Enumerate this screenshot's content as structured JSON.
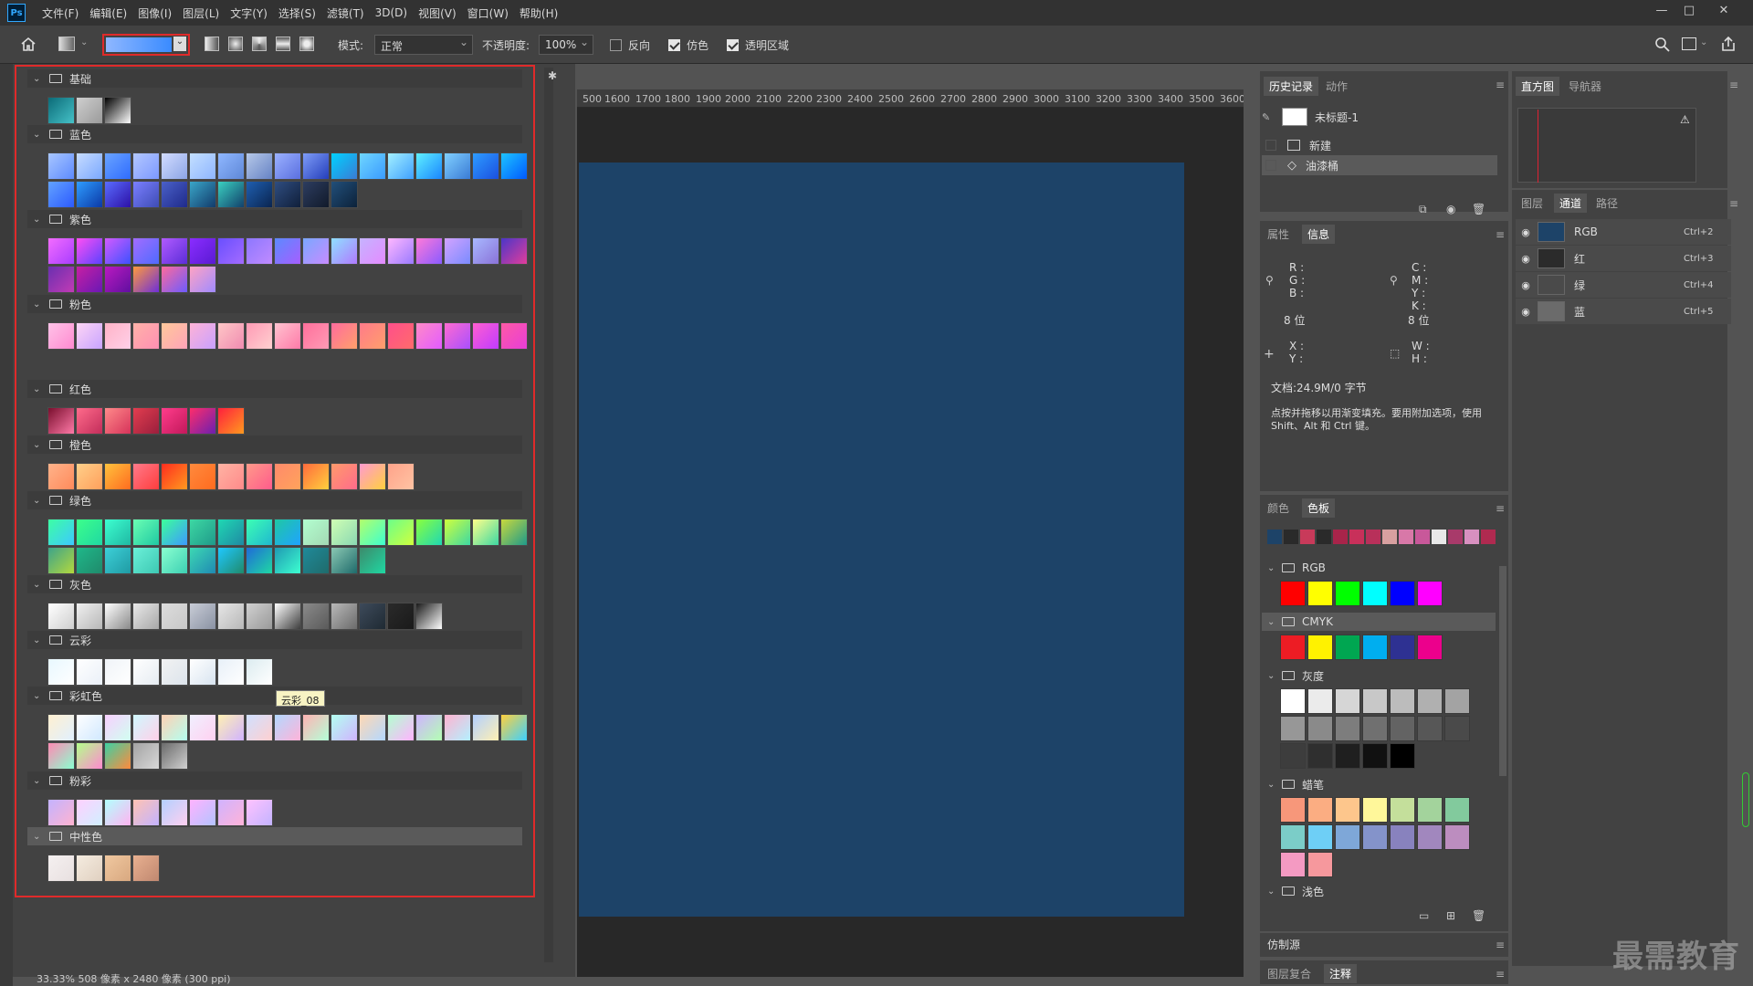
{
  "app": {
    "logo": "Ps"
  },
  "menu": [
    "文件(F)",
    "编辑(E)",
    "图像(I)",
    "图层(L)",
    "文字(Y)",
    "选择(S)",
    "滤镜(T)",
    "3D(D)",
    "视图(V)",
    "窗口(W)",
    "帮助(H)"
  ],
  "window_controls": {
    "minimize": "—",
    "restore": "□",
    "close": "✕"
  },
  "options": {
    "mode_label": "模式:",
    "mode_value": "正常",
    "opacity_label": "不透明度:",
    "opacity_value": "100%",
    "reverse_label": "反向",
    "reverse_checked": false,
    "dither_label": "仿色",
    "dither_checked": true,
    "transparency_label": "透明区域",
    "transparency_checked": true
  },
  "gradient_panel": {
    "groups": [
      {
        "name": "基础",
        "swatches": [
          [
            "#0b6b78",
            "#46c2c8"
          ],
          [
            "#cfcfcf",
            "#9a9a9a"
          ],
          [
            "#000000",
            "#ffffff"
          ]
        ]
      },
      {
        "name": "蓝色",
        "swatches": [
          [
            "#a8c6ff",
            "#5d8bff"
          ],
          [
            "#c7dcff",
            "#7aa8ff"
          ],
          [
            "#6aa4ff",
            "#2f6cff"
          ],
          [
            "#b3c7ff",
            "#7c99ff"
          ],
          [
            "#d2dcff",
            "#8ca5e6"
          ],
          [
            "#c3dfff",
            "#8fb6ff"
          ],
          [
            "#8fb7ff",
            "#5f88d8"
          ],
          [
            "#b6c8e8",
            "#6683c5"
          ],
          [
            "#9bb1ff",
            "#5a6fe0"
          ],
          [
            "#7e9cf7",
            "#243ebb"
          ],
          [
            "#00d2ff",
            "#3a7bd5"
          ],
          [
            "#6fd6ff",
            "#3a9bff"
          ],
          [
            "#a3f0ff",
            "#3fa0ff"
          ],
          [
            "#5ef0ff",
            "#1a86ff"
          ],
          [
            "#80d0ff",
            "#3a7bd5"
          ],
          [
            "#2d9cff",
            "#1b4fe0"
          ],
          [
            "#1dc4ff",
            "#0059ff"
          ],
          [
            "#62a2ff",
            "#2c5aff"
          ],
          [
            "#2e9cff",
            "#0b39a6"
          ],
          [
            "#5a6cff",
            "#2c10a6"
          ],
          [
            "#7a7fff",
            "#3e4cb5"
          ],
          [
            "#4a60c8",
            "#1f2a8a"
          ],
          [
            "#3aa6c8",
            "#123b6b"
          ],
          [
            "#3ad0c0",
            "#12406b"
          ],
          [
            "#1f5eb0",
            "#0a2550"
          ],
          [
            "#2f4d80",
            "#101f3a"
          ],
          [
            "#2d3d60",
            "#111a2a"
          ],
          [
            "#224f7a",
            "#0c223a"
          ]
        ]
      },
      {
        "name": "紫色",
        "swatches": [
          [
            "#f36cff",
            "#a83dff"
          ],
          [
            "#ff4ff3",
            "#5b42ff"
          ],
          [
            "#d35bff",
            "#3d51ff"
          ],
          [
            "#a26cff",
            "#4f6bff"
          ],
          [
            "#b15bff",
            "#5b2dd8"
          ],
          [
            "#8a2dff",
            "#5a1ad3"
          ],
          [
            "#6a4fff",
            "#a36bff"
          ],
          [
            "#8d77ff",
            "#c08bff"
          ],
          [
            "#5c8aff",
            "#a65eff"
          ],
          [
            "#7aa8ff",
            "#c78bff"
          ],
          [
            "#8fe0ff",
            "#b07aff"
          ],
          [
            "#c5b3ff",
            "#e48bff"
          ],
          [
            "#ffb7ff",
            "#9a7aff"
          ],
          [
            "#ff7ad9",
            "#8a5bff"
          ],
          [
            "#d3a3ff",
            "#7a8bff"
          ],
          [
            "#a8b8ff",
            "#8a72d8"
          ],
          [
            "#4a36c8",
            "#e23d9b"
          ],
          [
            "#6a2fb0",
            "#c23bb5"
          ],
          [
            "#c71fa3",
            "#6a18b5"
          ],
          [
            "#ba1ac0",
            "#600fa0"
          ],
          [
            "#ff9a3d",
            "#6e2fd8"
          ],
          [
            "#ff6b9b",
            "#6d5bff"
          ],
          [
            "#ffa3c3",
            "#a08bff"
          ]
        ]
      },
      {
        "name": "粉色",
        "swatches": [
          [
            "#ffc3e8",
            "#ff8ad0"
          ],
          [
            "#ffd6f5",
            "#c7a3ff"
          ],
          [
            "#ffb3c7",
            "#ffd0e8"
          ],
          [
            "#ffb2a8",
            "#ff8fb3"
          ],
          [
            "#ffc89a",
            "#ffa3b8"
          ],
          [
            "#ffb3d6",
            "#c8a0ff"
          ],
          [
            "#ffc7c7",
            "#f08bb0"
          ],
          [
            "#ff9ab5",
            "#ffd0d0"
          ],
          [
            "#ffc3d0",
            "#ff7aa8"
          ],
          [
            "#ff6f9b",
            "#ff9bb5"
          ],
          [
            "#ff6b9d",
            "#ffa06b"
          ],
          [
            "#ff7a8a",
            "#ff9f6b"
          ],
          [
            "#ff4f8b",
            "#ff6b6b"
          ],
          [
            "#ff8ac7",
            "#e35bff"
          ],
          [
            "#ff6bd0",
            "#a84fff"
          ],
          [
            "#ff5fd0",
            "#c03bff"
          ],
          [
            "#ff5aa5",
            "#e83dd8"
          ]
        ]
      },
      {
        "name": "红色",
        "swatches": [
          [
            "#7a0f2e",
            "#ff7aa8"
          ],
          [
            "#ff6b8b",
            "#c22d5a"
          ],
          [
            "#ff8a8a",
            "#d6335a"
          ],
          [
            "#e23d4f",
            "#9a1f3d"
          ],
          [
            "#ff3d8b",
            "#c2185b"
          ],
          [
            "#ff2d6b",
            "#6b1fb0"
          ],
          [
            "#ff1f3d",
            "#ff9a1f"
          ]
        ]
      },
      {
        "name": "橙色",
        "swatches": [
          [
            "#ffb38a",
            "#ff8a5b"
          ],
          [
            "#ffd08a",
            "#ff9f5b"
          ],
          [
            "#ffc23d",
            "#ff6b1f"
          ],
          [
            "#ff7a8a",
            "#ff3d3d"
          ],
          [
            "#ff2d1f",
            "#ff9a1f"
          ],
          [
            "#ff8a3d",
            "#ff6b1f"
          ],
          [
            "#ffb3a3",
            "#ff8a8a"
          ],
          [
            "#ff9a8a",
            "#ff5b8b"
          ],
          [
            "#ff8a6b",
            "#ffa35b"
          ],
          [
            "#ff6b3d",
            "#ffd03d"
          ],
          [
            "#ff9a6b",
            "#ff6b8b"
          ],
          [
            "#ff9ad0",
            "#ffd03d"
          ],
          [
            "#ffa38a",
            "#ffc3a3"
          ]
        ]
      },
      {
        "name": "绿色",
        "swatches": [
          [
            "#3dffa3",
            "#3dc8ff"
          ],
          [
            "#3dff8a",
            "#1fd8a3"
          ],
          [
            "#3dffd0",
            "#1fb8a3"
          ],
          [
            "#6bffb3",
            "#1fc8a3"
          ],
          [
            "#3dff9a",
            "#3d9aff"
          ],
          [
            "#3dd8a3",
            "#1f9a8a"
          ],
          [
            "#1fd8b3",
            "#1f8aa3"
          ],
          [
            "#3dffb3",
            "#1fb8d0"
          ],
          [
            "#1fc8a3",
            "#1fa3ff"
          ],
          [
            "#b3ffd0",
            "#a3d8b3"
          ],
          [
            "#d0ffb3",
            "#8ad8b3"
          ],
          [
            "#b3ff6b",
            "#3dffd0"
          ],
          [
            "#6bff8a",
            "#d0ff3d"
          ],
          [
            "#8aff3d",
            "#1fd8b3"
          ],
          [
            "#d0ff3d",
            "#3dd8a3"
          ],
          [
            "#ffff8a",
            "#3dd8a3"
          ],
          [
            "#c8d83d",
            "#1f9a8a"
          ],
          [
            "#3da38a",
            "#b3d83d"
          ],
          [
            "#1fb88a",
            "#1f8a6b"
          ],
          [
            "#3dd0d8",
            "#1f9aa3"
          ],
          [
            "#6bf0d8",
            "#3dc8b3"
          ],
          [
            "#8affd0",
            "#3dd0b3"
          ],
          [
            "#3dd8b3",
            "#1f8ab3"
          ],
          [
            "#1fc8ff",
            "#1f8a6b"
          ],
          [
            "#1f6bd8",
            "#1fd8a3"
          ],
          [
            "#1f9ab3",
            "#3dffd0"
          ],
          [
            "#1f8a9a",
            "#1f6b6b"
          ],
          [
            "#8ac8b3",
            "#1f6b6b"
          ],
          [
            "#3d8a6b",
            "#1fd8a3"
          ]
        ]
      },
      {
        "name": "灰色",
        "swatches": [
          [
            "#ffffff",
            "#cfcfcf"
          ],
          [
            "#f0f0f0",
            "#b8b8b8"
          ],
          [
            "#ffffff",
            "#8a8a8a"
          ],
          [
            "#e8e8e8",
            "#a8a8a8"
          ],
          [
            "#dcdcdc",
            "#c8c8c8"
          ],
          [
            "#c8ccd6",
            "#8a92a3"
          ],
          [
            "#e6e6e6",
            "#b8b8b8"
          ],
          [
            "#d0d0d0",
            "#9a9a9a"
          ],
          [
            "#ffffff",
            "#3d3d3d"
          ],
          [
            "#8a8a8a",
            "#5a5a5a"
          ],
          [
            "#b8b8b8",
            "#6b6b6b"
          ],
          [
            "#3d4a5a",
            "#1f2a33"
          ],
          [
            "#2a2a2a",
            "#1a1a1a"
          ],
          [
            "#1a1a1a",
            "#ffffff"
          ]
        ]
      },
      {
        "name": "云彩",
        "swatches": [
          [
            "#e8f8ff",
            "#ffffff"
          ],
          [
            "#ffffff",
            "#eaf0f8"
          ],
          [
            "#f0f4f8",
            "#ffffff"
          ],
          [
            "#ffffff",
            "#e6ecf2"
          ],
          [
            "#f2f2f2",
            "#dce4ec"
          ],
          [
            "#ffffff",
            "#d8e4f0"
          ],
          [
            "#e8f0f8",
            "#ffffff"
          ],
          [
            "#dcecf0",
            "#ffffff"
          ]
        ]
      },
      {
        "name": "彩虹色",
        "swatches": [
          [
            "#fff0d0",
            "#e0f0ff"
          ],
          [
            "#ffffff",
            "#d0e8ff"
          ],
          [
            "#f8d0ff",
            "#d0fff0"
          ],
          [
            "#d0f8ff",
            "#ffd0e8"
          ],
          [
            "#ffd0b3",
            "#b3fff0"
          ],
          [
            "#f0f0ff",
            "#ffd0f0"
          ],
          [
            "#fff0b3",
            "#d0b3ff"
          ],
          [
            "#d0e0ff",
            "#ffd0d0"
          ],
          [
            "#b3d8ff",
            "#ffb3d8"
          ],
          [
            "#ffb3b3",
            "#b3ffd8"
          ],
          [
            "#b3fff0",
            "#d0b3ff"
          ],
          [
            "#ffd8b3",
            "#b3d8ff"
          ],
          [
            "#b3ffd0",
            "#ffb3ff"
          ],
          [
            "#d0b3ff",
            "#b3ffb3"
          ],
          [
            "#ffb3d0",
            "#b3f0ff"
          ],
          [
            "#b3d0ff",
            "#fff0b3"
          ],
          [
            "#ffd03d",
            "#3dd0ff"
          ],
          [
            "#ff8ab3",
            "#8affd0"
          ],
          [
            "#b3ff8a",
            "#ff8ad0"
          ],
          [
            "#3dd0a3",
            "#ff8a3d"
          ],
          [
            "#a3a3a3",
            "#d8d8d8"
          ],
          [
            "#6b6b6b",
            "#d0d0d0"
          ]
        ]
      },
      {
        "name": "粉彩",
        "swatches": [
          [
            "#c3b3ff",
            "#ffb3d0"
          ],
          [
            "#ffd0ff",
            "#d0f0ff"
          ],
          [
            "#b3ffff",
            "#ffb3f0"
          ],
          [
            "#ffc3b3",
            "#c3b3ff"
          ],
          [
            "#b3d0ff",
            "#ffd0f0"
          ],
          [
            "#ffb3ff",
            "#b3c3ff"
          ],
          [
            "#d0b3ff",
            "#ffb3d8"
          ],
          [
            "#ffc3ff",
            "#c3b3ff"
          ]
        ]
      },
      {
        "name": "中性色",
        "swatches": [
          [
            "#f5f0f0",
            "#e8e0e0"
          ],
          [
            "#f5ece0",
            "#e0d0c0"
          ],
          [
            "#f0c8a0",
            "#d8a880"
          ],
          [
            "#e8b090",
            "#c08870"
          ]
        ]
      }
    ],
    "tooltip": "云彩_08"
  },
  "ruler_ticks": [
    "500",
    "1600",
    "1700",
    "1800",
    "1900",
    "2000",
    "2100",
    "2200",
    "2300",
    "2400",
    "2500",
    "2600",
    "2700",
    "2800",
    "2900",
    "3000",
    "3100",
    "3200",
    "3300",
    "3400",
    "3500",
    "3600"
  ],
  "status": "33.33% 508 像素 x 2480 像素 (300 ppi)",
  "history": {
    "tabs": [
      "历史记录",
      "动作"
    ],
    "snapshot": "未标题-1",
    "items": [
      "新建",
      "油漆桶"
    ]
  },
  "histogram": {
    "tabs": [
      "直方图",
      "导航器"
    ]
  },
  "layers": {
    "tabs": [
      "图层",
      "通道",
      "路径"
    ],
    "channels": [
      {
        "name": "RGB",
        "key": "Ctrl+2",
        "color": "#1d4368"
      },
      {
        "name": "红",
        "key": "Ctrl+3",
        "color": "#2b2b2b"
      },
      {
        "name": "绿",
        "key": "Ctrl+4",
        "color": "#4a4a4a"
      },
      {
        "name": "蓝",
        "key": "Ctrl+5",
        "color": "#6b6b6b"
      }
    ]
  },
  "info": {
    "tabs": [
      "属性",
      "信息"
    ],
    "rgb_labels": [
      "R :",
      "G :",
      "B :"
    ],
    "cmyk_labels": [
      "C :",
      "M :",
      "Y :",
      "K :"
    ],
    "bits_left": "8 位",
    "bits_right": "8 位",
    "xy_labels": [
      "X :",
      "Y :"
    ],
    "wh_labels": [
      "W :",
      "H :"
    ],
    "doc_size": "文档:24.9M/0 字节",
    "hint": "点按并拖移以用渐变填充。要用附加选项，使用 Shift、Alt 和 Ctrl 键。"
  },
  "swatches_panel": {
    "tabs": [
      "颜色",
      "色板"
    ],
    "recent": [
      "#1d4368",
      "#2a2a2a",
      "#c83a5a",
      "#2a2a2a",
      "#a8244a",
      "#c8305a",
      "#b8305a",
      "#d8a0a0",
      "#d878a8",
      "#c8589a",
      "#e8e8e8",
      "#a83a6a",
      "#d890c0",
      "#b02a50"
    ],
    "groups": [
      {
        "name": "RGB",
        "colors": [
          "#ff0000",
          "#ffff00",
          "#00ff00",
          "#00ffff",
          "#0000ff",
          "#ff00ff"
        ]
      },
      {
        "name": "CMYK",
        "colors": [
          "#ed1c24",
          "#fff200",
          "#00a651",
          "#00aeef",
          "#2e3192",
          "#ec008c"
        ]
      },
      {
        "name": "灰度",
        "colors": [
          "#ffffff",
          "#ebebeb",
          "#d6d6d6",
          "#c8c8c8",
          "#bcbcbc",
          "#b0b0b0",
          "#a3a3a3",
          "#979797",
          "#8a8a8a",
          "#7d7d7d",
          "#707070",
          "#636363",
          "#575757",
          "#4a4a4a",
          "#3d3d3d",
          "#2f2f2f",
          "#1f1f1f",
          "#111111",
          "#000000"
        ]
      },
      {
        "name": "蜡笔",
        "colors": [
          "#f7977a",
          "#fbad82",
          "#fdc68c",
          "#fff79a",
          "#c4df9b",
          "#a3d39c",
          "#82ca9d",
          "#7bcdc8",
          "#6ecff6",
          "#7ea7d8",
          "#8493ca",
          "#8882be",
          "#a187be",
          "#bc8dbf",
          "#f49ac2",
          "#f6989d"
        ]
      },
      {
        "name": "浅色",
        "colors": []
      }
    ]
  },
  "clone_panel": {
    "tabs": [
      "仿制源"
    ]
  },
  "bottom_panel": {
    "tabs": [
      "图层复合",
      "注释"
    ]
  },
  "watermark": "最需教育"
}
